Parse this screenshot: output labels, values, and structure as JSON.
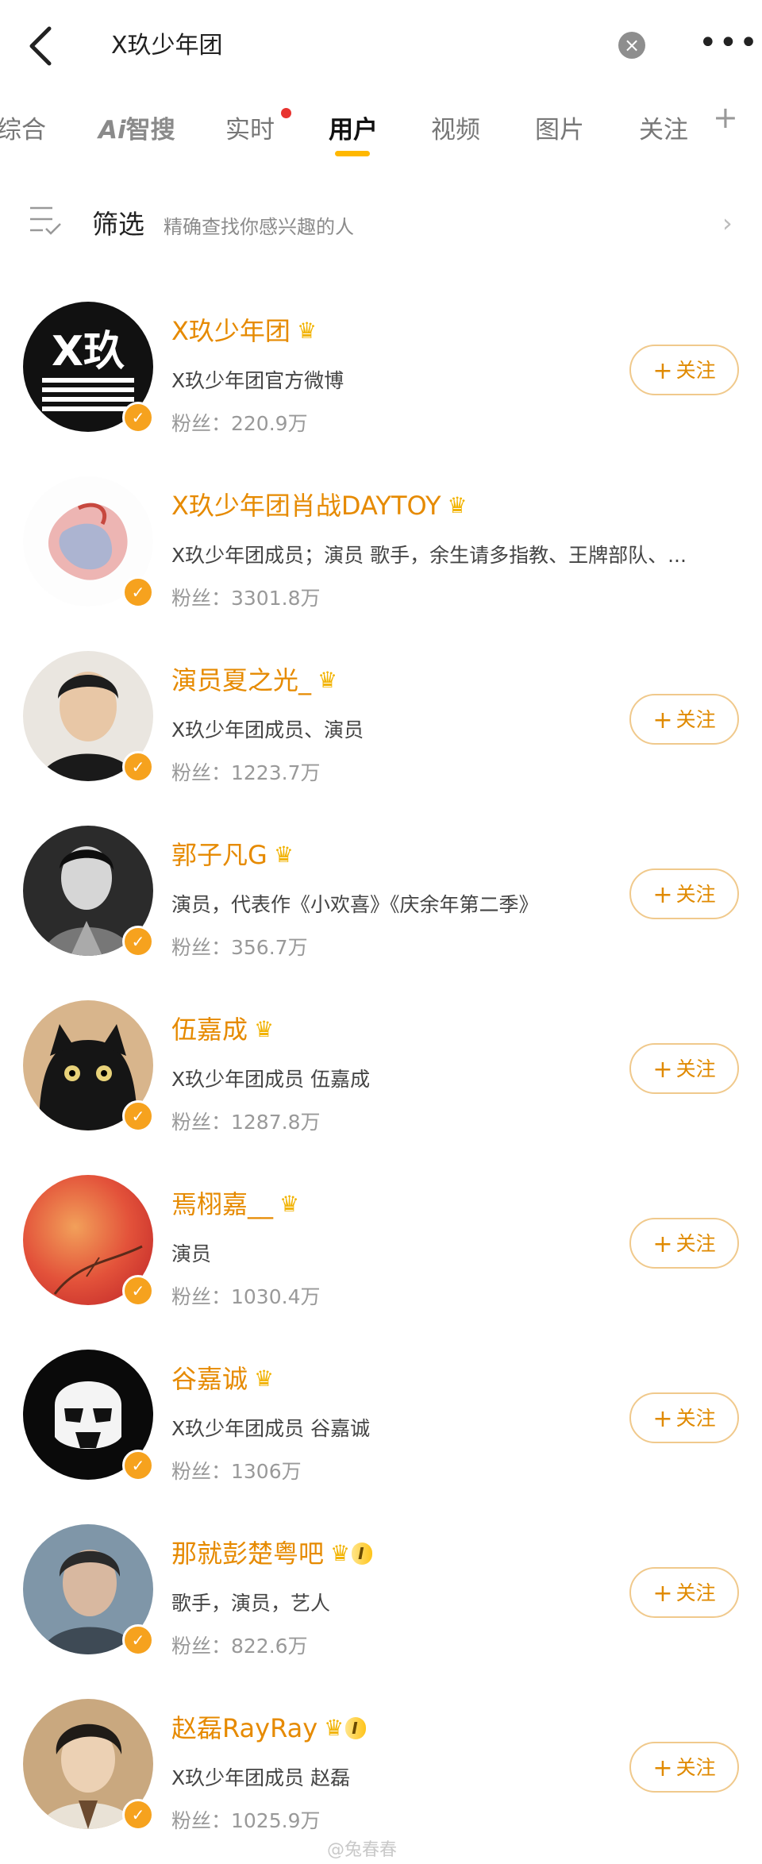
{
  "topbar": {
    "query": "X玖少年团",
    "clear_glyph": "×",
    "more_glyph": "•••"
  },
  "tabs": [
    {
      "label": "综合"
    },
    {
      "label": "Ai"
    },
    {
      "label": "智搜"
    },
    {
      "label": "实时"
    },
    {
      "label": "用户"
    },
    {
      "label": "视频"
    },
    {
      "label": "图片"
    },
    {
      "label": "关注"
    }
  ],
  "tab_plus": "+",
  "filter": {
    "title": "筛选",
    "hint": "精确查找你感兴趣的人",
    "chevron": "›"
  },
  "follow_label": "关注",
  "follow_plus": "+",
  "users": [
    {
      "name": "X玖少年团",
      "desc": "X玖少年团官方微博",
      "fans": "粉丝：220.9万",
      "has_follow": true,
      "badge": "crown"
    },
    {
      "name": "X玖少年团肖战DAYTOY",
      "desc": "X玖少年团成员；演员 歌手，余生请多指教、王牌部队、...",
      "fans": "粉丝：3301.8万",
      "has_follow": false,
      "badge": "crown"
    },
    {
      "name": "演员夏之光_",
      "desc": "X玖少年团成员、演员",
      "fans": "粉丝：1223.7万",
      "has_follow": true,
      "badge": "crown"
    },
    {
      "name": "郭子凡G",
      "desc": "演员，代表作《小欢喜》《庆余年第二季》",
      "fans": "粉丝：356.7万",
      "has_follow": true,
      "badge": "crown"
    },
    {
      "name": "伍嘉成",
      "desc": "X玖少年团成员 伍嘉成",
      "fans": "粉丝：1287.8万",
      "has_follow": true,
      "badge": "crown"
    },
    {
      "name": "焉栩嘉__",
      "desc": "演员",
      "fans": "粉丝：1030.4万",
      "has_follow": true,
      "badge": "crown"
    },
    {
      "name": "谷嘉诚",
      "desc": "X玖少年团成员 谷嘉诚",
      "fans": "粉丝：1306万",
      "has_follow": true,
      "badge": "crown"
    },
    {
      "name": "那就彭楚粤吧",
      "desc": "歌手，演员，艺人",
      "fans": "粉丝：822.6万",
      "has_follow": true,
      "badge": "vip"
    },
    {
      "name": "赵磊RayRay",
      "desc": "X玖少年团成员 赵磊",
      "fans": "粉丝：1025.9万",
      "has_follow": true,
      "badge": "vip"
    }
  ],
  "vip_label": "I",
  "verified_glyph": "✓",
  "watermark": "@兔春春",
  "colors": {
    "accent": "#ffb800",
    "name": "#e68a00",
    "follow_border": "#f0c98c",
    "badge": "#f6a21e"
  }
}
